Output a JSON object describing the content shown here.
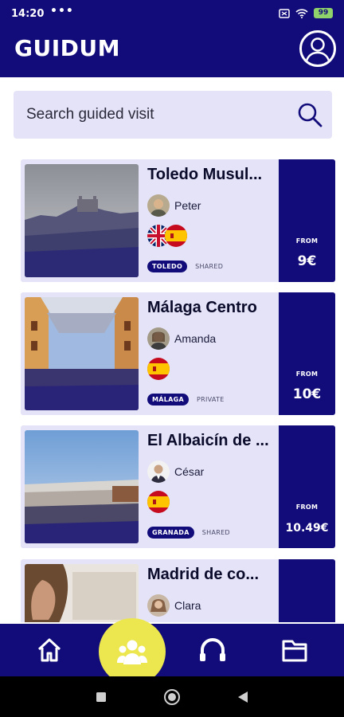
{
  "status": {
    "time": "14:20",
    "dots": "•••",
    "battery": "99"
  },
  "header": {
    "logo": "GUIDUM"
  },
  "search": {
    "placeholder": "Search guided visit"
  },
  "tours": [
    {
      "title": "Toledo Musul...",
      "guide": "Peter",
      "languages": [
        "gb",
        "es"
      ],
      "city": "TOLEDO",
      "mode": "SHARED",
      "from_label": "FROM",
      "price": "9€"
    },
    {
      "title": "Málaga Centro",
      "guide": "Amanda",
      "languages": [
        "es"
      ],
      "city": "MÁLAGA",
      "mode": "PRIVATE",
      "from_label": "FROM",
      "price": "10€"
    },
    {
      "title": "El Albaicín de ...",
      "guide": "César",
      "languages": [
        "es"
      ],
      "city": "GRANADA",
      "mode": "SHARED",
      "from_label": "FROM",
      "price": "10.49€"
    },
    {
      "title": "Madrid de co...",
      "guide": "Clara",
      "languages": [],
      "city": "",
      "mode": "",
      "from_label": "",
      "price": ""
    }
  ],
  "nav": [
    "home-icon",
    "group-icon",
    "headphones-icon",
    "folder-icon"
  ],
  "colors": {
    "brand": "#120c7a",
    "accent": "#ece74e",
    "card": "#e4e3f8"
  }
}
